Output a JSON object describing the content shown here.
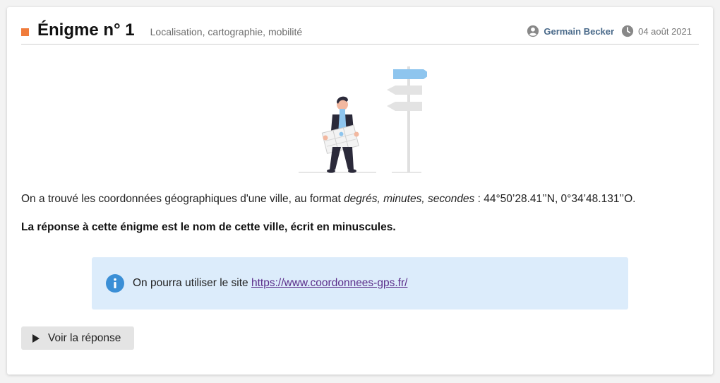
{
  "header": {
    "title": "Énigme n° 1",
    "subtitle": "Localisation, cartographie, mobilité",
    "author": "Germain Becker",
    "date": "04 août 2021"
  },
  "content": {
    "para_prefix": "On a trouvé les coordonnées géographiques d'une ville, au format ",
    "para_italic": "degrés, minutes, secondes",
    "para_suffix": " : 44°50’28.41’’N, 0°34’48.131’’O.",
    "answer_instruction": "La réponse à cette énigme est le nom de cette ville, écrit en minuscules."
  },
  "info_box": {
    "text": "On pourra utiliser le site ",
    "link_text": "https://www.coordonnees-gps.fr/"
  },
  "button": {
    "label": "Voir la réponse"
  },
  "colors": {
    "accent": "#f07c3c",
    "info_bg": "#dcecfb",
    "info_icon": "#3b8fd6",
    "link": "#5b2d8a",
    "button_bg": "#e4e4e4"
  },
  "icons": [
    "user-icon",
    "clock-icon",
    "info-icon",
    "play-icon",
    "signpost-illustration"
  ]
}
